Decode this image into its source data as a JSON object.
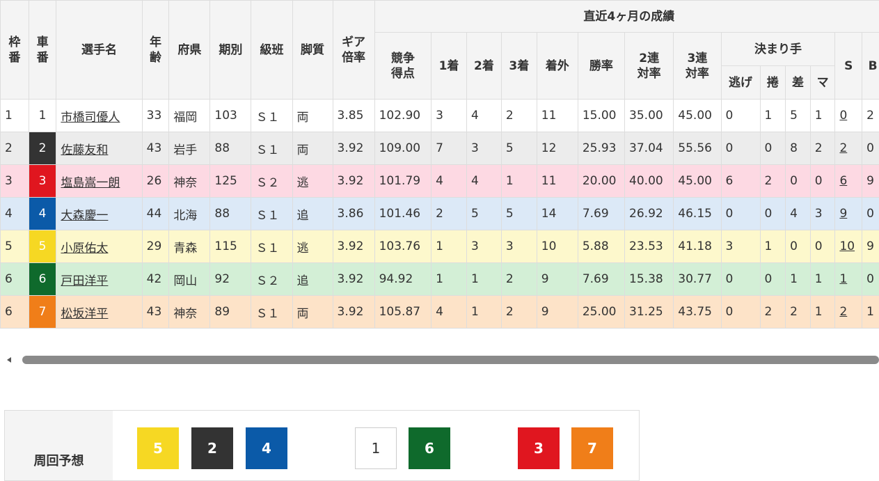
{
  "headers": {
    "waku": "枠番",
    "sha": "車番",
    "name": "選手名",
    "age": "年齢",
    "pref": "府県",
    "term": "期別",
    "class": "級班",
    "style": "脚質",
    "gear": "ギア倍率",
    "recent_group": "直近4ヶ月の成績",
    "score": "競争得点",
    "first": "1着",
    "second": "2着",
    "third": "3着",
    "out": "着外",
    "win_rate": "勝率",
    "ren2": "2連対率",
    "ren3": "3連対率",
    "kimarite_group": "決まり手",
    "nige": "逃げ",
    "makuri": "捲",
    "sashi": "差",
    "mark": "マ",
    "s": "S",
    "b": "B"
  },
  "rows": [
    {
      "waku": "1",
      "sha": "1",
      "name": "市橋司優人",
      "age": "33",
      "pref": "福岡",
      "term": "103",
      "class": "Ｓ１",
      "style": "両",
      "gear": "3.85",
      "score": "102.90",
      "first": "3",
      "second": "4",
      "third": "2",
      "out": "11",
      "win_rate": "15.00",
      "ren2": "35.00",
      "ren3": "45.00",
      "nige": "0",
      "makuri": "1",
      "sashi": "5",
      "mark": "1",
      "s": "0",
      "b": "2",
      "row_bg": "#ffffff",
      "car_bg": "#ffffff",
      "car_fg": "#333333"
    },
    {
      "waku": "2",
      "sha": "2",
      "name": "佐藤友和",
      "age": "43",
      "pref": "岩手",
      "term": "88",
      "class": "Ｓ１",
      "style": "両",
      "gear": "3.92",
      "score": "109.00",
      "first": "7",
      "second": "3",
      "third": "5",
      "out": "12",
      "win_rate": "25.93",
      "ren2": "37.04",
      "ren3": "55.56",
      "nige": "0",
      "makuri": "0",
      "sashi": "8",
      "mark": "2",
      "s": "2",
      "b": "0",
      "row_bg": "#ececec",
      "car_bg": "#333333",
      "car_fg": "#ffffff"
    },
    {
      "waku": "3",
      "sha": "3",
      "name": "塩島嵩一朗",
      "age": "26",
      "pref": "神奈",
      "term": "125",
      "class": "Ｓ２",
      "style": "逃",
      "gear": "3.92",
      "score": "101.79",
      "first": "4",
      "second": "4",
      "third": "1",
      "out": "11",
      "win_rate": "20.00",
      "ren2": "40.00",
      "ren3": "45.00",
      "nige": "6",
      "makuri": "2",
      "sashi": "0",
      "mark": "0",
      "s": "6",
      "b": "9",
      "row_bg": "#fdd9e3",
      "car_bg": "#e0161f",
      "car_fg": "#ffffff"
    },
    {
      "waku": "4",
      "sha": "4",
      "name": "大森慶一",
      "age": "44",
      "pref": "北海",
      "term": "88",
      "class": "Ｓ１",
      "style": "追",
      "gear": "3.86",
      "score": "101.46",
      "first": "2",
      "second": "5",
      "third": "5",
      "out": "14",
      "win_rate": "7.69",
      "ren2": "26.92",
      "ren3": "46.15",
      "nige": "0",
      "makuri": "0",
      "sashi": "4",
      "mark": "3",
      "s": "9",
      "b": "0",
      "row_bg": "#dce9f7",
      "car_bg": "#0b5aa8",
      "car_fg": "#ffffff"
    },
    {
      "waku": "5",
      "sha": "5",
      "name": "小原佑太",
      "age": "29",
      "pref": "青森",
      "term": "115",
      "class": "Ｓ１",
      "style": "逃",
      "gear": "3.92",
      "score": "103.76",
      "first": "1",
      "second": "3",
      "third": "3",
      "out": "10",
      "win_rate": "5.88",
      "ren2": "23.53",
      "ren3": "41.18",
      "nige": "3",
      "makuri": "1",
      "sashi": "0",
      "mark": "0",
      "s": "10",
      "b": "9",
      "row_bg": "#fdf8cc",
      "car_bg": "#f6d823",
      "car_fg": "#ffffff"
    },
    {
      "waku": "6",
      "sha": "6",
      "name": "戸田洋平",
      "age": "42",
      "pref": "岡山",
      "term": "92",
      "class": "Ｓ２",
      "style": "追",
      "gear": "3.92",
      "score": "94.92",
      "first": "1",
      "second": "1",
      "third": "2",
      "out": "9",
      "win_rate": "7.69",
      "ren2": "15.38",
      "ren3": "30.77",
      "nige": "0",
      "makuri": "0",
      "sashi": "1",
      "mark": "1",
      "s": "1",
      "b": "0",
      "row_bg": "#d3efd6",
      "car_bg": "#0f6a2c",
      "car_fg": "#ffffff"
    },
    {
      "waku": "6",
      "sha": "7",
      "name": "松坂洋平",
      "age": "43",
      "pref": "神奈",
      "term": "89",
      "class": "Ｓ１",
      "style": "両",
      "gear": "3.92",
      "score": "105.87",
      "first": "4",
      "second": "1",
      "third": "2",
      "out": "9",
      "win_rate": "25.00",
      "ren2": "31.25",
      "ren3": "43.75",
      "nige": "0",
      "makuri": "2",
      "sashi": "2",
      "mark": "1",
      "s": "2",
      "b": "1",
      "row_bg": "#fde3c8",
      "car_bg": "#f07e19",
      "car_fg": "#ffffff"
    }
  ],
  "prediction": {
    "label": "周回予想",
    "chips": [
      {
        "num": "5",
        "bg": "#f6d823",
        "fg": "#ffffff",
        "border": "#f6d823"
      },
      {
        "num": "2",
        "bg": "#333333",
        "fg": "#ffffff",
        "border": "#333333"
      },
      {
        "num": "4",
        "bg": "#0b5aa8",
        "fg": "#ffffff",
        "border": "#0b5aa8"
      },
      {
        "num": "1",
        "bg": "#ffffff",
        "fg": "#333333",
        "border": "#cccccc"
      },
      {
        "num": "6",
        "bg": "#0f6a2c",
        "fg": "#ffffff",
        "border": "#0f6a2c"
      },
      {
        "num": "3",
        "bg": "#e0161f",
        "fg": "#ffffff",
        "border": "#e0161f"
      },
      {
        "num": "7",
        "bg": "#f07e19",
        "fg": "#ffffff",
        "border": "#f07e19"
      }
    ]
  }
}
